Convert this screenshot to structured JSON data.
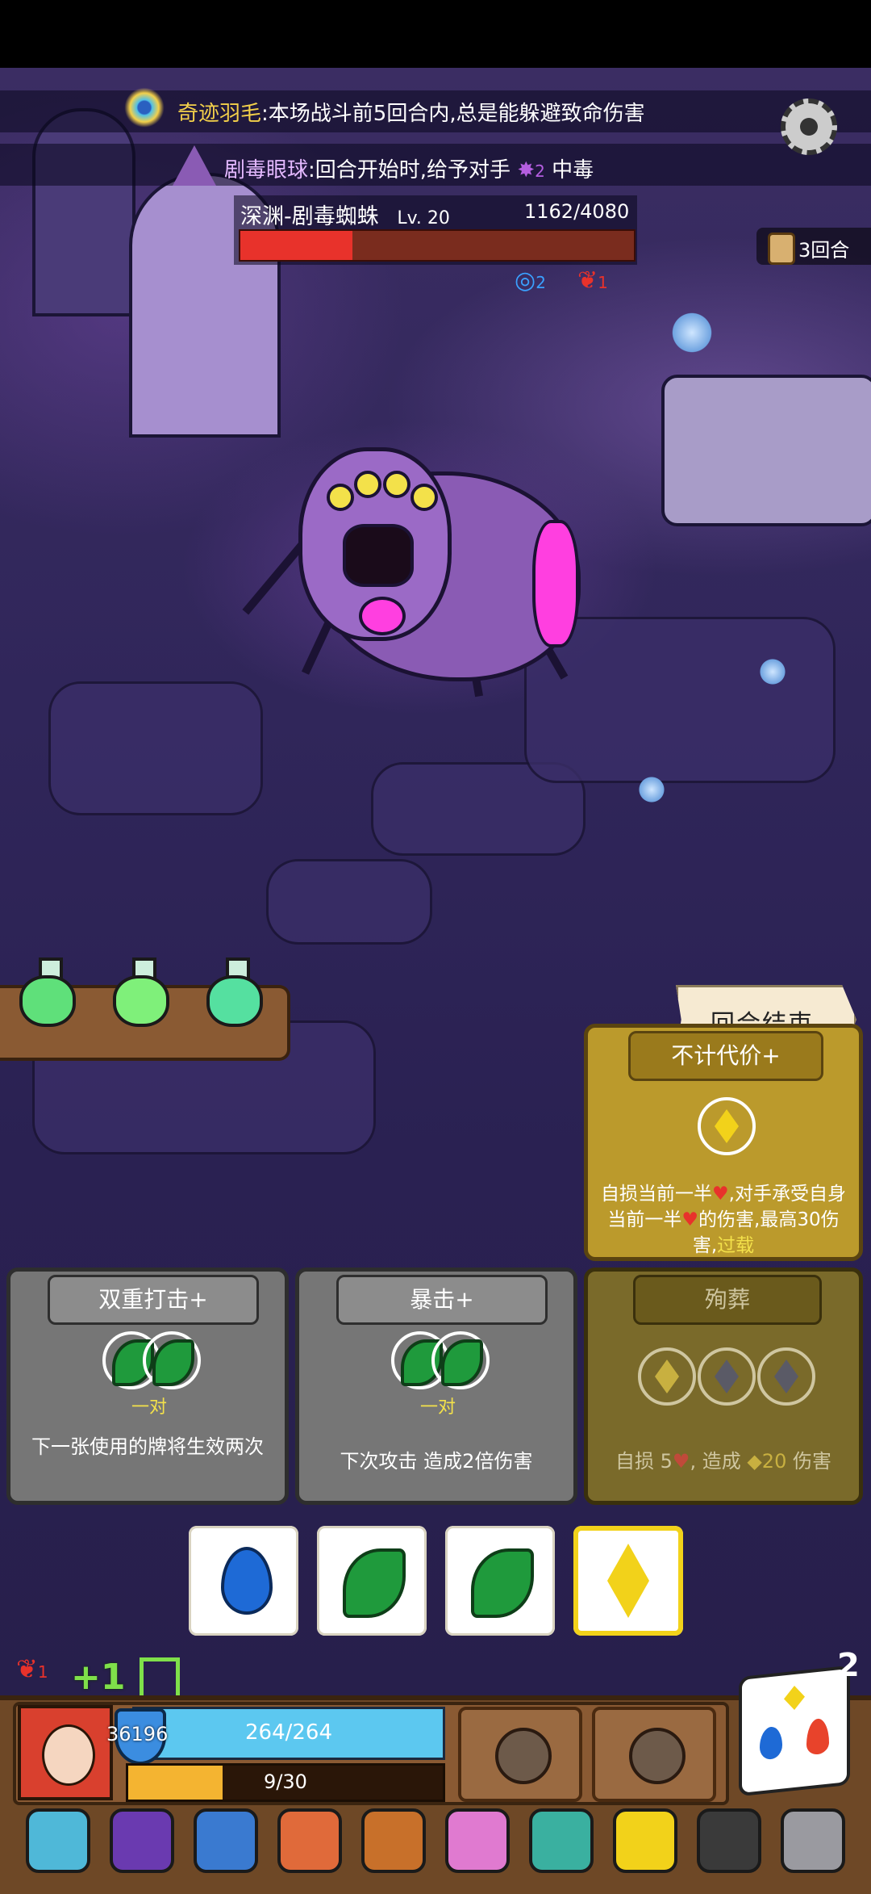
{
  "relics": [
    {
      "name": "奇迹羽毛",
      "desc": ":本场战斗前5回合内,总是能躲避致命伤害",
      "icon": "peacock-feather-icon"
    },
    {
      "name": "剧毒眼球",
      "desc": ":回合开始时,给予对手",
      "stack": "2",
      "effect": "中毒",
      "icon": "poison-eye-icon"
    }
  ],
  "enemy": {
    "name": "深渊-剧毒蜘蛛",
    "level": "Lv. 20",
    "hp_text": "1162/4080",
    "hp_current": 1162,
    "hp_max": 4080,
    "statuses": [
      {
        "icon": "vortex-icon",
        "value": "2",
        "color": "#3aa0ff"
      },
      {
        "icon": "bleed-icon",
        "value": "1",
        "color": "#e8322b"
      }
    ]
  },
  "turns": {
    "label": "3回合"
  },
  "potions": [
    {
      "icon": "green-potion-icon",
      "color": "#5fe07a"
    },
    {
      "icon": "green-potion-icon",
      "color": "#7ff07a"
    },
    {
      "icon": "teal-potion-icon",
      "color": "#55e0a0"
    }
  ],
  "end_turn": {
    "label": "回合结束"
  },
  "cards": [
    {
      "id": "bujidaijia",
      "title": "不计代价+",
      "desc_parts": [
        "自损当前一半",
        "♥",
        ",对手承受自身当前一半",
        "♥",
        "的伤害,最高30伤害,",
        "过载"
      ],
      "slots": [
        "diamond"
      ],
      "pair": ""
    },
    {
      "id": "shuangchong",
      "title": "双重打击+",
      "desc": "下一张使用的牌将生效两次",
      "slots": [
        "leaf",
        "leaf"
      ],
      "pair": "一对"
    },
    {
      "id": "baoji",
      "title": "暴击+",
      "desc": "下次攻击 造成2倍伤害",
      "slots": [
        "leaf",
        "leaf"
      ],
      "pair": "一对"
    },
    {
      "id": "xunzang",
      "title": "殉葬",
      "desc_parts": [
        "自损 5",
        "♥",
        ", 造成 ",
        "◆",
        "20",
        " 伤害"
      ],
      "slots": [
        "diamond",
        "diamond",
        "diamond"
      ],
      "pair": ""
    }
  ],
  "dice": [
    {
      "face": "water",
      "icon": "water-drop-icon",
      "color": "#1e6ad6",
      "selected": false
    },
    {
      "face": "leaf",
      "icon": "leaf-icon",
      "color": "#1f9a3c",
      "selected": false
    },
    {
      "face": "leaf",
      "icon": "leaf-icon",
      "color": "#1f9a3c",
      "selected": false
    },
    {
      "face": "diamond",
      "icon": "diamond-icon",
      "color": "#f2d21a",
      "selected": true
    }
  ],
  "player": {
    "hp_text": "264/264",
    "hp_fraction": 1.0,
    "exp_text": "9/30",
    "exp_fraction": 0.3,
    "armor": "36196",
    "buff_bleed": "1",
    "plus_label": "+1"
  },
  "die_count": "2",
  "inventory": [
    {
      "icon": "crystal-skull-icon",
      "color": "#4fb8d8"
    },
    {
      "icon": "wizard-hat-icon",
      "color": "#6a3ab0"
    },
    {
      "icon": "blue-tile-icon",
      "color": "#3a7ad0"
    },
    {
      "icon": "meat-leg-icon",
      "color": "#e06a3a"
    },
    {
      "icon": "leather-armor-icon",
      "color": "#c8702a"
    },
    {
      "icon": "pink-flower-icon",
      "color": "#e07ad0"
    },
    {
      "icon": "teal-vase-icon",
      "color": "#3ab0a0"
    },
    {
      "icon": "yellow-die-icon",
      "color": "#f2d21a"
    },
    {
      "icon": "dark-gem-icon",
      "color": "#3a3a3a"
    },
    {
      "icon": "silver-armor-icon",
      "color": "#9a9aa0"
    }
  ]
}
